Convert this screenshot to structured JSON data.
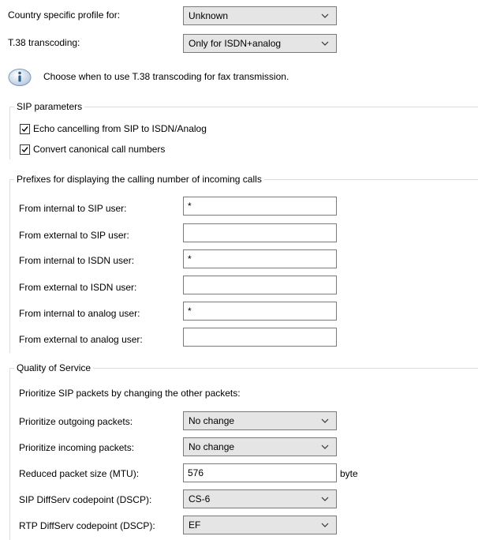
{
  "header": {
    "country_label": "Country specific profile for:",
    "country_value": "Unknown",
    "t38_label": "T.38 transcoding:",
    "t38_value": "Only for ISDN+analog",
    "info_text": "Choose when to use T.38 transcoding for fax transmission."
  },
  "sip": {
    "title": "SIP parameters",
    "echo_label": "Echo cancelling from SIP to ISDN/Analog",
    "echo_checked": true,
    "canonical_label": "Convert canonical call numbers",
    "canonical_checked": true
  },
  "prefixes": {
    "title": "Prefixes for displaying the calling number of incoming calls",
    "rows": [
      {
        "label": "From internal to SIP user:",
        "value": "*"
      },
      {
        "label": "From external to SIP user:",
        "value": ""
      },
      {
        "label": "From internal to ISDN user:",
        "value": "*"
      },
      {
        "label": "From external to ISDN user:",
        "value": ""
      },
      {
        "label": "From internal to analog user:",
        "value": "*"
      },
      {
        "label": "From external to analog user:",
        "value": ""
      }
    ]
  },
  "qos": {
    "title": "Quality of Service",
    "description": "Prioritize SIP packets by changing the other packets:",
    "outgoing_label": "Prioritize outgoing packets:",
    "outgoing_value": "No change",
    "incoming_label": "Prioritize incoming packets:",
    "incoming_value": "No change",
    "mtu_label": "Reduced packet size (MTU):",
    "mtu_value": "576",
    "mtu_unit": "byte",
    "sip_dscp_label": "SIP DiffServ codepoint (DSCP):",
    "sip_dscp_value": "CS-6",
    "rtp_dscp_label": "RTP DiffServ codepoint (DSCP):",
    "rtp_dscp_value": "EF"
  },
  "colors": {
    "select_bg": "#e5e5e5",
    "border": "#7a7a7a",
    "info_icon": "#3a6ea5"
  }
}
